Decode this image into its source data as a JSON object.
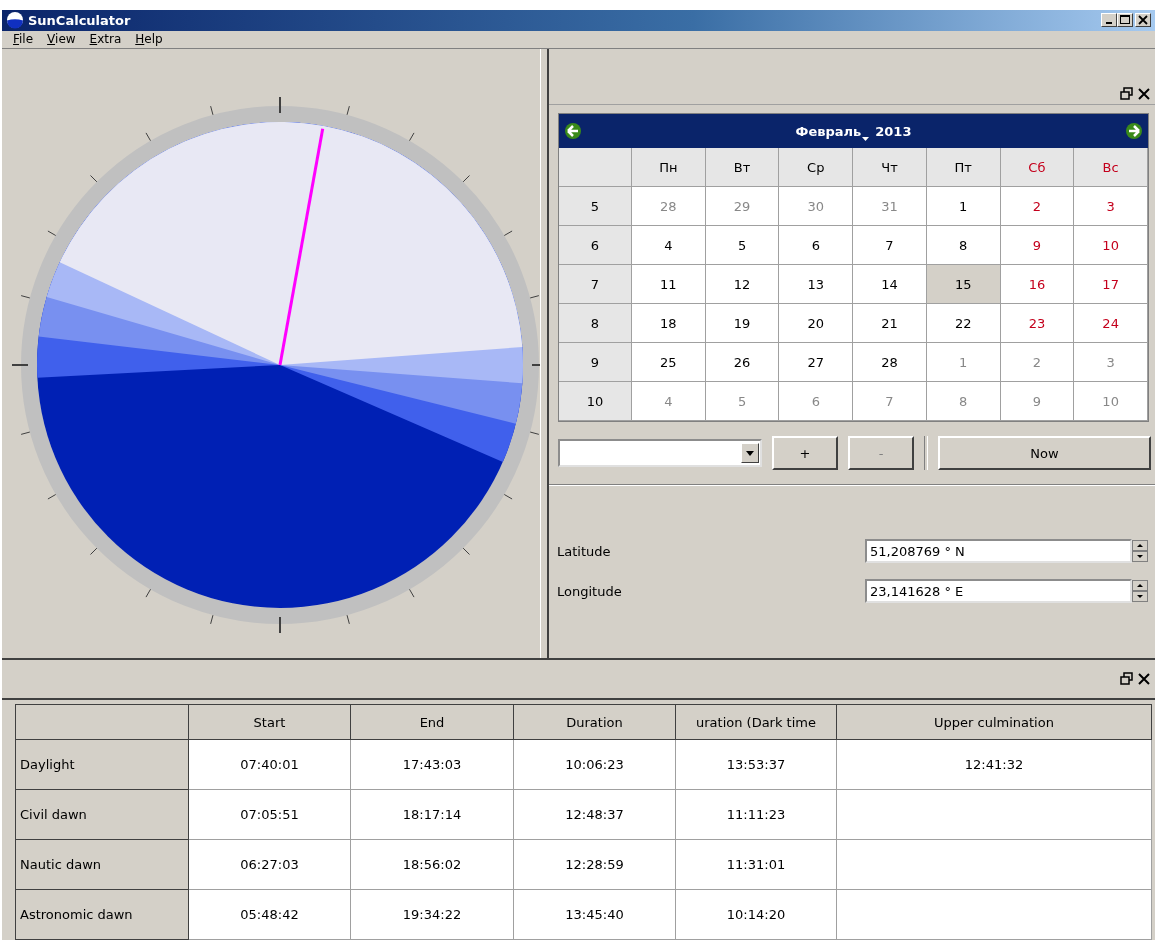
{
  "window": {
    "title": "SunCalculator"
  },
  "menu": [
    "File",
    "View",
    "Extra",
    "Help"
  ],
  "calendar": {
    "month": "Февраль",
    "year": "2013",
    "weekdays": [
      {
        "label": "Пн",
        "weekend": false
      },
      {
        "label": "Вт",
        "weekend": false
      },
      {
        "label": "Ср",
        "weekend": false
      },
      {
        "label": "Чт",
        "weekend": false
      },
      {
        "label": "Пт",
        "weekend": false
      },
      {
        "label": "Сб",
        "weekend": true
      },
      {
        "label": "Вс",
        "weekend": true
      }
    ],
    "weeks": [
      {
        "number": "5",
        "days": [
          {
            "day": "28",
            "kind": "other",
            "selected": false
          },
          {
            "day": "29",
            "kind": "other",
            "selected": false
          },
          {
            "day": "30",
            "kind": "other",
            "selected": false
          },
          {
            "day": "31",
            "kind": "other",
            "selected": false
          },
          {
            "day": "1",
            "kind": "weekday",
            "selected": false
          },
          {
            "day": "2",
            "kind": "weekend",
            "selected": false
          },
          {
            "day": "3",
            "kind": "weekend",
            "selected": false
          }
        ]
      },
      {
        "number": "6",
        "days": [
          {
            "day": "4",
            "kind": "weekday",
            "selected": false
          },
          {
            "day": "5",
            "kind": "weekday",
            "selected": false
          },
          {
            "day": "6",
            "kind": "weekday",
            "selected": false
          },
          {
            "day": "7",
            "kind": "weekday",
            "selected": false
          },
          {
            "day": "8",
            "kind": "weekday",
            "selected": false
          },
          {
            "day": "9",
            "kind": "weekend",
            "selected": false
          },
          {
            "day": "10",
            "kind": "weekend",
            "selected": false
          }
        ]
      },
      {
        "number": "7",
        "days": [
          {
            "day": "11",
            "kind": "weekday",
            "selected": false
          },
          {
            "day": "12",
            "kind": "weekday",
            "selected": false
          },
          {
            "day": "13",
            "kind": "weekday",
            "selected": false
          },
          {
            "day": "14",
            "kind": "weekday",
            "selected": false
          },
          {
            "day": "15",
            "kind": "weekday",
            "selected": true
          },
          {
            "day": "16",
            "kind": "weekend",
            "selected": false
          },
          {
            "day": "17",
            "kind": "weekend",
            "selected": false
          }
        ]
      },
      {
        "number": "8",
        "days": [
          {
            "day": "18",
            "kind": "weekday",
            "selected": false
          },
          {
            "day": "19",
            "kind": "weekday",
            "selected": false
          },
          {
            "day": "20",
            "kind": "weekday",
            "selected": false
          },
          {
            "day": "21",
            "kind": "weekday",
            "selected": false
          },
          {
            "day": "22",
            "kind": "weekday",
            "selected": false
          },
          {
            "day": "23",
            "kind": "weekend",
            "selected": false
          },
          {
            "day": "24",
            "kind": "weekend",
            "selected": false
          }
        ]
      },
      {
        "number": "9",
        "days": [
          {
            "day": "25",
            "kind": "weekday",
            "selected": false
          },
          {
            "day": "26",
            "kind": "weekday",
            "selected": false
          },
          {
            "day": "27",
            "kind": "weekday",
            "selected": false
          },
          {
            "day": "28",
            "kind": "weekday",
            "selected": false
          },
          {
            "day": "1",
            "kind": "other",
            "selected": false
          },
          {
            "day": "2",
            "kind": "other",
            "selected": false
          },
          {
            "day": "3",
            "kind": "other",
            "selected": false
          }
        ]
      },
      {
        "number": "10",
        "days": [
          {
            "day": "4",
            "kind": "other",
            "selected": false
          },
          {
            "day": "5",
            "kind": "other",
            "selected": false
          },
          {
            "day": "6",
            "kind": "other",
            "selected": false
          },
          {
            "day": "7",
            "kind": "other",
            "selected": false
          },
          {
            "day": "8",
            "kind": "other",
            "selected": false
          },
          {
            "day": "9",
            "kind": "other",
            "selected": false
          },
          {
            "day": "10",
            "kind": "other",
            "selected": false
          }
        ]
      }
    ]
  },
  "controls": {
    "plus": "+",
    "minus": "-",
    "now": "Now"
  },
  "location": [
    {
      "label": "Latitude",
      "value": "51,208769 ° N"
    },
    {
      "label": "Longitude",
      "value": "23,141628 ° E"
    }
  ],
  "table": {
    "columns": [
      "Start",
      "End",
      "Duration",
      "uration (Dark time",
      "Upper culmination"
    ],
    "rows": [
      {
        "label": "Daylight",
        "cells": [
          "07:40:01",
          "17:43:03",
          "10:06:23",
          "13:53:37",
          "12:41:32"
        ]
      },
      {
        "label": "Civil dawn",
        "cells": [
          "07:05:51",
          "18:17:14",
          "12:48:37",
          "11:11:23"
        ]
      },
      {
        "label": "Nautic dawn",
        "cells": [
          "06:27:03",
          "18:56:02",
          "12:28:59",
          "11:31:01"
        ]
      },
      {
        "label": "Astronomic dawn",
        "cells": [
          "05:48:42",
          "19:34:22",
          "13:45:40",
          "10:14:20"
        ]
      }
    ]
  }
}
